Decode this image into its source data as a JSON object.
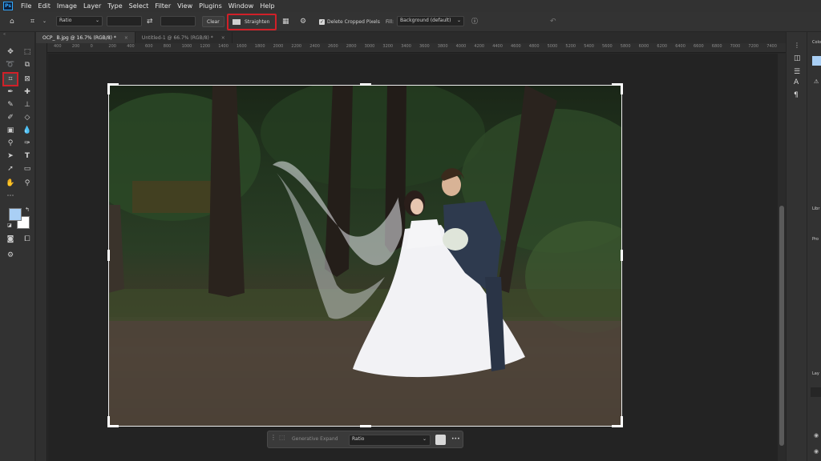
{
  "menu": {
    "logo": "Ps",
    "items": [
      "File",
      "Edit",
      "Image",
      "Layer",
      "Type",
      "Select",
      "Filter",
      "View",
      "Plugins",
      "Window",
      "Help"
    ]
  },
  "options": {
    "ratio_value": "Ratio",
    "clear_label": "Clear",
    "straighten_label": "Straighten",
    "delete_cropped_label": "Delete Cropped Pixels",
    "delete_cropped_checked": true,
    "fill_label": "Fill:",
    "fill_value": "Background (default)"
  },
  "tabs": [
    {
      "label": "OCP_ B.jpg @ 16.7% (RGB/8) *",
      "close": "×",
      "active": true
    },
    {
      "label": "Untitled-1 @ 66.7% (RGB/8) *",
      "close": "×",
      "active": false
    }
  ],
  "ruler_ticks": [
    "400",
    "200",
    "0",
    "200",
    "400",
    "600",
    "800",
    "1000",
    "1200",
    "1400",
    "1600",
    "1800",
    "2000",
    "2200",
    "2400",
    "2600",
    "2800",
    "3000",
    "3200",
    "3400",
    "3600",
    "3800",
    "4000",
    "4200",
    "4400",
    "4600",
    "4800",
    "5000",
    "5200",
    "5400",
    "5600",
    "5800",
    "6000",
    "6200",
    "6400",
    "6600",
    "6800",
    "7000",
    "7200",
    "7400"
  ],
  "context_bar": {
    "generative_expand_label": "Generative Expand",
    "ratio_value": "Ratio",
    "more_label": "•••"
  },
  "right_panel": {
    "labels": [
      "Colo",
      "Libr",
      "Pro",
      "Lay"
    ]
  },
  "colors": {
    "highlight": "#d02028",
    "foreground_swatch": "#a9cff5",
    "background_swatch": "#ffffff"
  }
}
